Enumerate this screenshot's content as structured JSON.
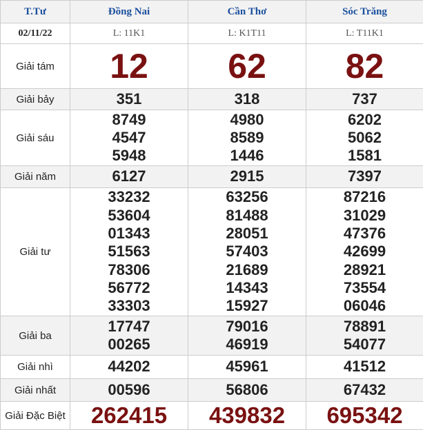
{
  "header": {
    "col_label": "T.Tư",
    "provinces": [
      "Đồng Nai",
      "Cần Thơ",
      "Sóc Trăng"
    ]
  },
  "draw": {
    "date": "02/11/22",
    "codes": [
      "L: 11K1",
      "L: K1T11",
      "L: T11K1"
    ]
  },
  "prizes": {
    "g8": {
      "label": "Giải tám",
      "values": [
        [
          "12"
        ],
        [
          "62"
        ],
        [
          "82"
        ]
      ]
    },
    "g7": {
      "label": "Giải bảy",
      "values": [
        [
          "351"
        ],
        [
          "318"
        ],
        [
          "737"
        ]
      ]
    },
    "g6": {
      "label": "Giải sáu",
      "values": [
        [
          "8749",
          "4547",
          "5948"
        ],
        [
          "4980",
          "8589",
          "1446"
        ],
        [
          "6202",
          "5062",
          "1581"
        ]
      ]
    },
    "g5": {
      "label": "Giải năm",
      "values": [
        [
          "6127"
        ],
        [
          "2915"
        ],
        [
          "7397"
        ]
      ]
    },
    "g4": {
      "label": "Giải tư",
      "values": [
        [
          "33232",
          "53604",
          "01343",
          "51563",
          "78306",
          "56772",
          "33303"
        ],
        [
          "63256",
          "81488",
          "28051",
          "57403",
          "21689",
          "14343",
          "15927"
        ],
        [
          "87216",
          "31029",
          "47376",
          "42699",
          "28921",
          "73554",
          "06046"
        ]
      ]
    },
    "g3": {
      "label": "Giải ba",
      "values": [
        [
          "17747",
          "00265"
        ],
        [
          "79016",
          "46919"
        ],
        [
          "78891",
          "54077"
        ]
      ]
    },
    "g2": {
      "label": "Giải nhì",
      "values": [
        [
          "44202"
        ],
        [
          "45961"
        ],
        [
          "41512"
        ]
      ]
    },
    "g1": {
      "label": "Giải nhất",
      "values": [
        [
          "00596"
        ],
        [
          "56806"
        ],
        [
          "67432"
        ]
      ]
    },
    "db": {
      "label": "Giải Đặc Biệt",
      "values": [
        [
          "262415"
        ],
        [
          "439832"
        ],
        [
          "695342"
        ]
      ]
    }
  },
  "colors": {
    "header_text": "#1a4f9e",
    "highlight_number": "#7a1111",
    "alt_row_bg": "#f2f2f2",
    "border": "#cccccc"
  }
}
